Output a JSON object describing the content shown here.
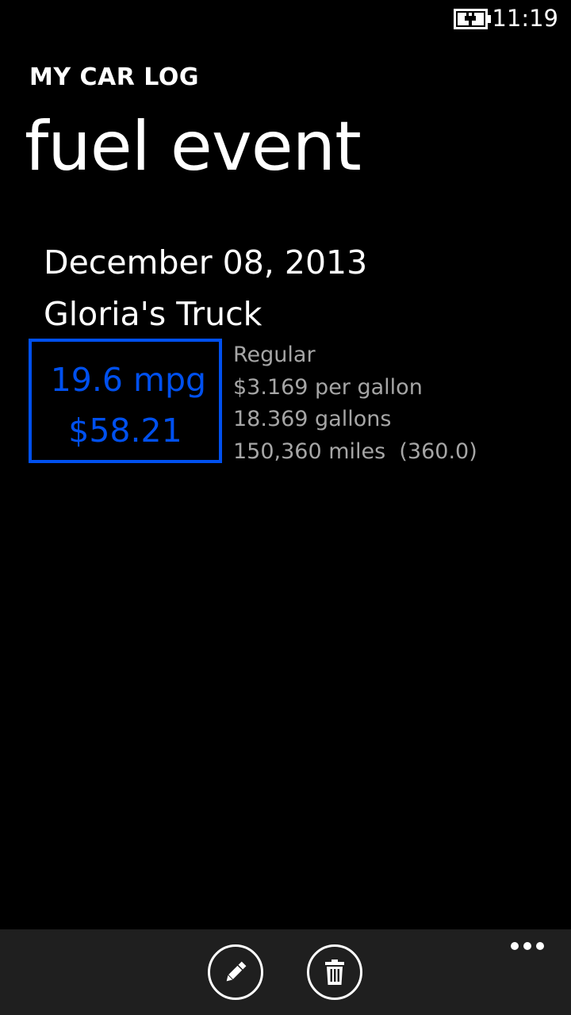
{
  "status_bar": {
    "time": "11:19",
    "battery_icon": "battery-charging-icon"
  },
  "header": {
    "app_title": "MY CAR LOG",
    "page_title": "fuel event"
  },
  "event": {
    "date": "December 08, 2013",
    "vehicle": "Gloria's Truck",
    "mpg": "19.6 mpg",
    "total_cost": "$58.21",
    "fuel_grade": "Regular",
    "price_per_gallon": "$3.169 per gallon",
    "gallons": "18.369 gallons",
    "odometer": "150,360 miles  (360.0)"
  },
  "app_bar": {
    "buttons": [
      {
        "name": "edit",
        "icon": "pencil-icon"
      },
      {
        "name": "delete",
        "icon": "trash-icon"
      }
    ],
    "more_icon": "ellipsis-icon"
  },
  "colors": {
    "accent": "#0050EF",
    "background": "#000000",
    "secondary_text": "#a6a6a6",
    "app_bar_bg": "#1f1f1f"
  }
}
